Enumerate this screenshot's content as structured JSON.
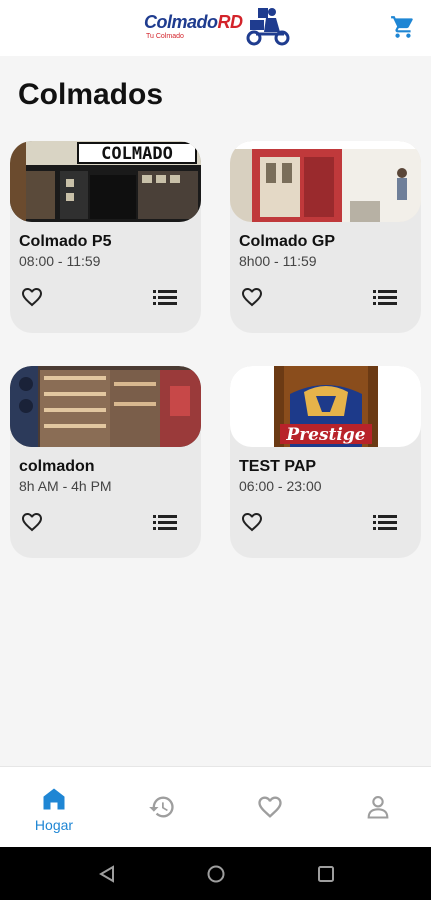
{
  "header": {
    "logo": {
      "brand_a": "Colmado",
      "brand_b": "RD",
      "tagline": "Tu Colmado"
    }
  },
  "page": {
    "title": "Colmados"
  },
  "colmados": [
    {
      "name": "Colmado P5",
      "hours": "08:00 - 11:59"
    },
    {
      "name": "Colmado GP",
      "hours": "8h00 - 11:59"
    },
    {
      "name": "colmadon",
      "hours": "8h AM - 4h PM"
    },
    {
      "name": "TEST PAP",
      "hours": "06:00 - 23:00"
    }
  ],
  "photo_labels": {
    "store_sign": "COLMADO",
    "beer_brand": "Prestige"
  },
  "bottom_nav": {
    "items": [
      {
        "label": "Hogar",
        "icon": "home-icon",
        "active": true
      },
      {
        "label": "",
        "icon": "history-icon",
        "active": false
      },
      {
        "label": "",
        "icon": "heart-icon",
        "active": false
      },
      {
        "label": "",
        "icon": "person-icon",
        "active": false
      }
    ]
  },
  "colors": {
    "accent": "#1f86d4",
    "brand_blue": "#1f3c8f",
    "brand_red": "#d3232a",
    "card_bg": "#e9e9e9",
    "inactive_icon": "#9e9e9e"
  }
}
